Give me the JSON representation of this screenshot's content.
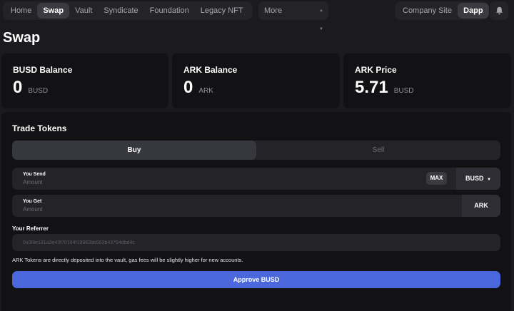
{
  "nav": {
    "items": [
      {
        "label": "Home",
        "active": false
      },
      {
        "label": "Swap",
        "active": true
      },
      {
        "label": "Vault",
        "active": false
      },
      {
        "label": "Syndicate",
        "active": false
      },
      {
        "label": "Foundation",
        "active": false
      },
      {
        "label": "Legacy NFT",
        "active": false
      }
    ],
    "more_label": "More",
    "company_site_label": "Company Site",
    "dapp_label": "Dapp",
    "bell_icon": "bell-icon"
  },
  "page": {
    "title": "Swap"
  },
  "stats": [
    {
      "label": "BUSD Balance",
      "value": "0",
      "unit": "BUSD"
    },
    {
      "label": "ARK Balance",
      "value": "0",
      "unit": "ARK"
    },
    {
      "label": "ARK Price",
      "value": "5.71",
      "unit": "BUSD"
    }
  ],
  "trade": {
    "title": "Trade Tokens",
    "tabs": [
      {
        "label": "Buy",
        "active": true
      },
      {
        "label": "Sell",
        "active": false
      }
    ],
    "send": {
      "label": "You Send",
      "placeholder": "Amount",
      "max_label": "MAX",
      "token": "BUSD"
    },
    "get": {
      "label": "You Get",
      "placeholder": "Amount",
      "token": "ARK"
    },
    "referrer": {
      "label": "Your Referrer",
      "placeholder": "0x0f8e181a3e43f70104f19983bb593b43794dbd4c"
    },
    "notice": "ARK Tokens are directly deposited into the vault, gas fees will be slightly higher for new accounts.",
    "approve_label": "Approve BUSD"
  },
  "colors": {
    "background": "#1b1b1f",
    "card": "#121215",
    "surface": "#232328",
    "accent": "#4b67dc"
  }
}
